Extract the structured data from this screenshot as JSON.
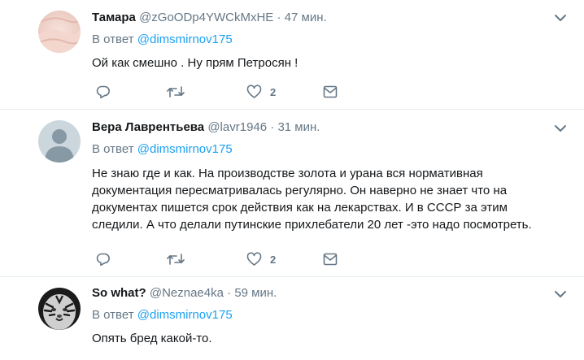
{
  "tweets": [
    {
      "name": "Тамара",
      "handle": "@zGoODp4YWCkMxHE",
      "dot": "·",
      "time": "47 мин.",
      "reply_prefix": "В ответ",
      "reply_mention": "@dimsmirnov175",
      "text": "Ой как смешно . Ну прям Петросян !",
      "likes": "2",
      "avatar_icon": "pink-fabric-avatar"
    },
    {
      "name": "Вера Лаврентьева",
      "handle": "@lavr1946",
      "dot": "·",
      "time": "31 мин.",
      "reply_prefix": "В ответ",
      "reply_mention": "@dimsmirnov175",
      "text_lines": [
        "Не знаю где и как. На производстве золота и урана вся нормативная",
        "документация пересматривалась регулярно. Он наверно не знает что на",
        "документах пишется срок действия как на лекарствах.  И в СССР за этим",
        "следили. А что делали путинские прихлебатели 20 лет -это надо посмотреть."
      ],
      "likes": "2",
      "avatar_icon": "default-person-avatar"
    },
    {
      "name": "So what?",
      "handle": "@Neznae4ka",
      "dot": "·",
      "time": "59 мин.",
      "reply_prefix": "В ответ",
      "reply_mention": "@dimsmirnov175",
      "text": "Опять бред какой-то.",
      "avatar_icon": "tiger-avatar"
    }
  ],
  "icons": [
    "reply-icon",
    "retweet-icon",
    "like-icon",
    "share-icon",
    "chevron-down-icon"
  ],
  "colors": {
    "text": "#14171a",
    "secondary": "#657786",
    "link": "#1da1f2",
    "divider": "#e6ecf0"
  }
}
